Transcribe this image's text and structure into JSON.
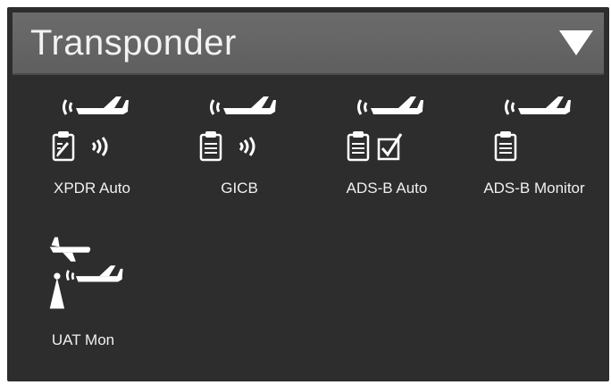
{
  "header": {
    "title": "Transponder"
  },
  "modes": [
    {
      "label": "XPDR Auto",
      "icons": [
        "airplane-signal-icon",
        "clipboard-edit-icon",
        "signal-waves-icon"
      ]
    },
    {
      "label": "GICB",
      "icons": [
        "airplane-signal-icon",
        "clipboard-icon",
        "signal-waves-icon"
      ]
    },
    {
      "label": "ADS-B Auto",
      "icons": [
        "airplane-signal-icon",
        "clipboard-icon",
        "checkbox-checked-icon"
      ]
    },
    {
      "label": "ADS-B Monitor",
      "icons": [
        "airplane-signal-icon",
        "clipboard-icon"
      ]
    },
    {
      "label": "UAT Mon",
      "icons": [
        "airplane-icon",
        "antenna-tower-icon",
        "airplane-signal-icon"
      ]
    }
  ],
  "colors": {
    "background": "#2d2d2d",
    "header": "#666666",
    "foreground": "#f0f0f0"
  }
}
